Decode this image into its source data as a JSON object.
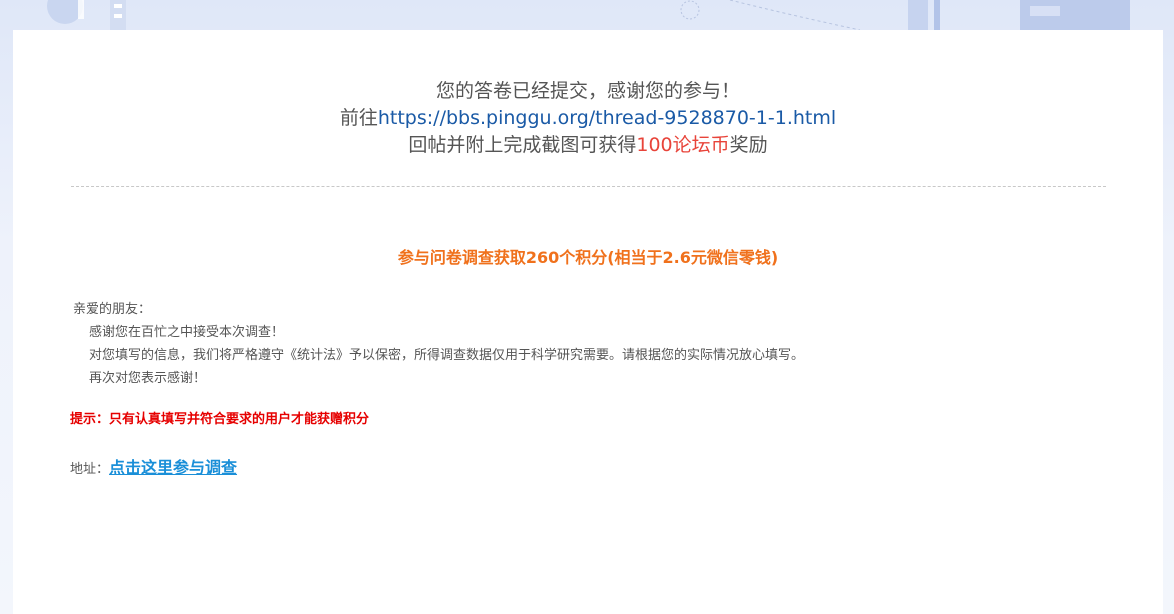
{
  "header": {
    "line1": "您的答卷已经提交，感谢您的参与！",
    "line2_prefix": "前往",
    "line2_link": "https://bbs.pinggu.org/thread-9528870-1-1.html",
    "line3_prefix": "回帖并附上完成截图可获得",
    "line3_highlight": "100论坛币",
    "line3_suffix": "奖励"
  },
  "survey": {
    "title": "参与问卷调查获取260个积分(相当于2.6元微信零钱)"
  },
  "letter": {
    "greeting": "亲爱的朋友：",
    "lines": [
      "感谢您在百忙之中接受本次调查！",
      "对您填写的信息，我们将严格遵守《统计法》予以保密，所得调查数据仅用于科学研究需要。请根据您的实际情况放心填写。",
      "再次对您表示感谢！"
    ]
  },
  "tip": {
    "text": "提示：只有认真填写并符合要求的用户才能获赠积分"
  },
  "address": {
    "label": "地址：",
    "link_text": "点击这里参与调查"
  },
  "colors": {
    "link_blue": "#1a5aa6",
    "highlight_red": "#e8443a",
    "title_orange": "#f0711c",
    "tip_red": "#e60000",
    "survey_link": "#1a8fd8"
  }
}
